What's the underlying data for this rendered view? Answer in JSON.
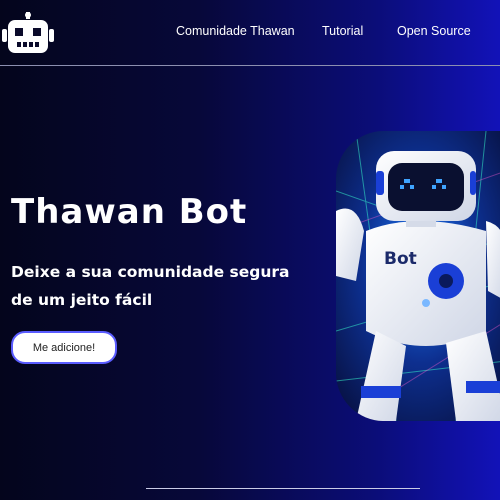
{
  "nav": {
    "links": [
      {
        "label": "Comunidade Thawan"
      },
      {
        "label": "Tutorial"
      },
      {
        "label": "Open Source"
      }
    ]
  },
  "hero": {
    "title": "Thawan Bot",
    "subtitle": "Deixe a sua comunidade segura de um jeito fácil",
    "cta_label": "Me adicione!",
    "image_text": "Bot"
  },
  "colors": {
    "background_start": "#04051c",
    "background_end": "#1212b8",
    "button_border": "#5a5cff",
    "robot_accent": "#1a3fd6"
  },
  "icons": {
    "logo": "robot-head-icon"
  }
}
